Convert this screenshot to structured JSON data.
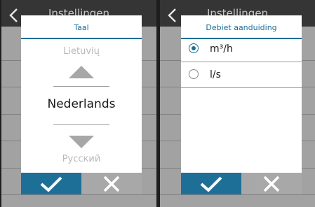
{
  "screens": [
    {
      "header_title": "Instellingen",
      "dialog": {
        "title": "Taal",
        "previous_option": "Lietuvių",
        "current_option": "Nederlands",
        "next_option": "Русский"
      }
    },
    {
      "header_title": "Instellingen",
      "dialog": {
        "title": "Debiet aanduiding",
        "options": [
          {
            "label": "m³/h",
            "selected": true
          },
          {
            "label": "l/s",
            "selected": false
          }
        ]
      }
    }
  ],
  "icons": {
    "back": "chevron-left-icon",
    "scroll_up": "triangle-up-icon",
    "scroll_down": "triangle-down-icon",
    "confirm": "check-icon",
    "cancel": "close-icon"
  },
  "colors": {
    "accent": "#1e6f98",
    "header": "#353535",
    "backdrop": "#a2a2a2",
    "dialog": "#ffffff"
  }
}
